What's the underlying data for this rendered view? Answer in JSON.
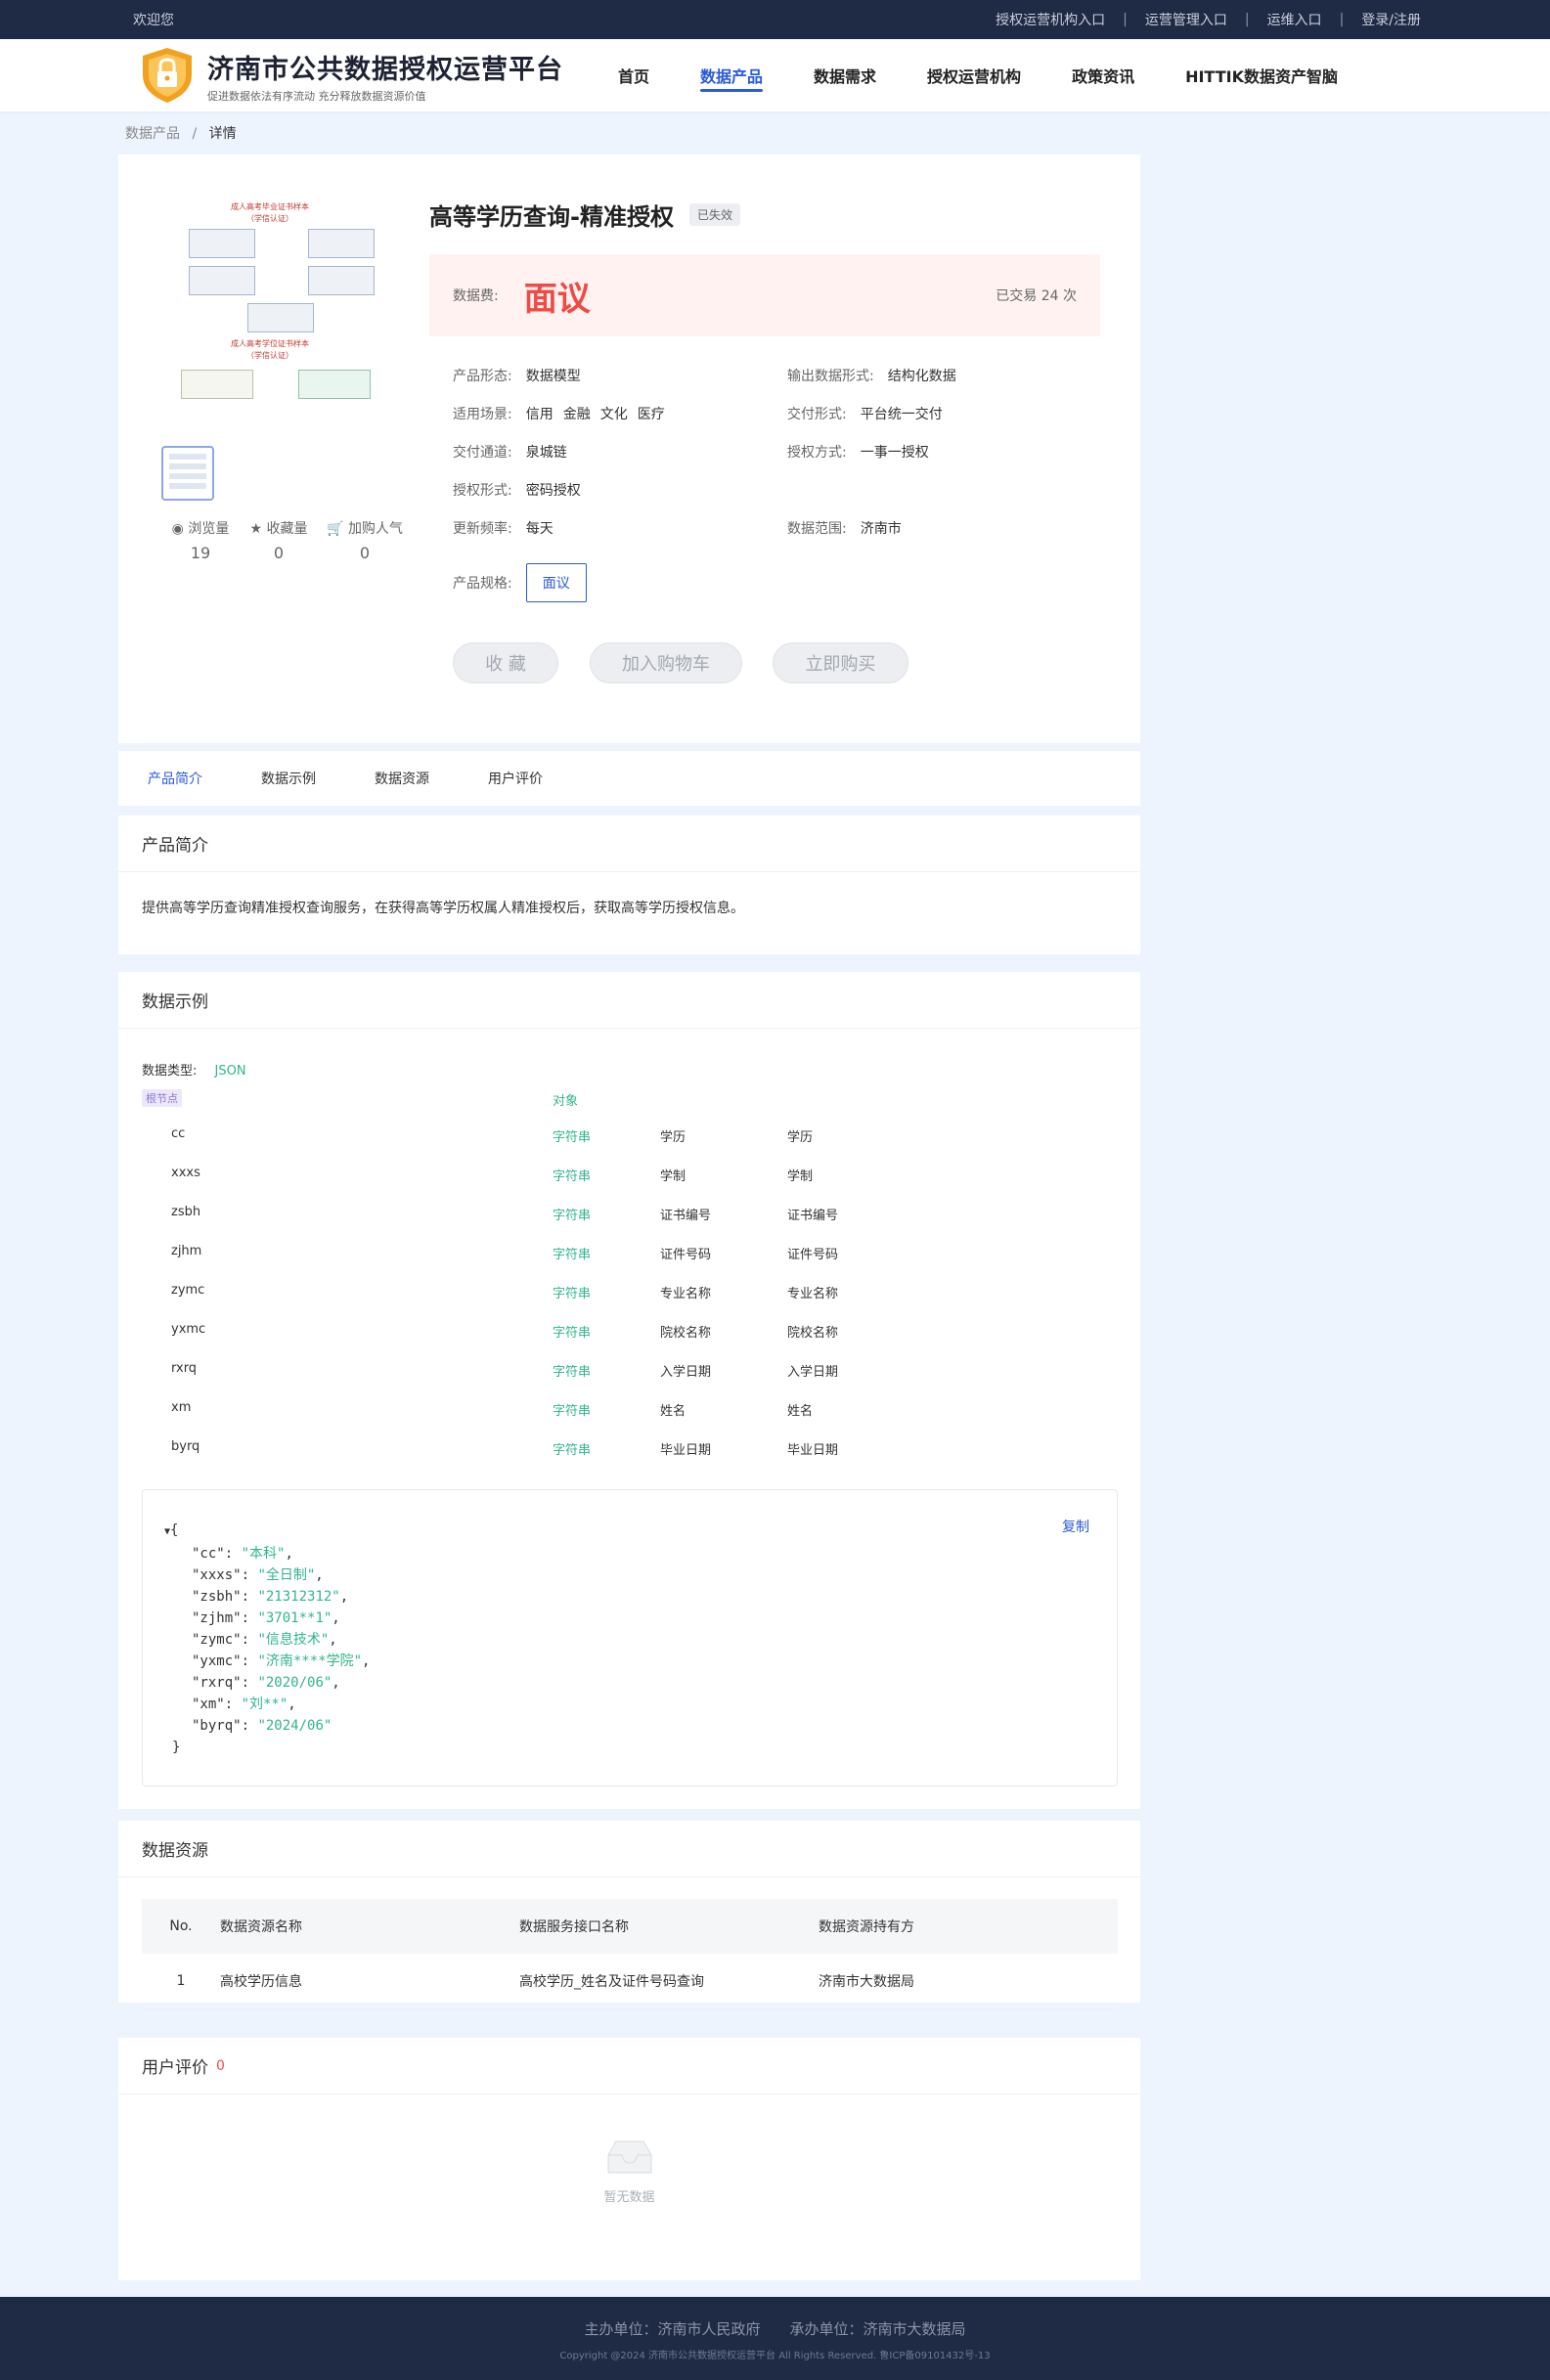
{
  "topbar": {
    "welcome": "欢迎您",
    "links": [
      "授权运营机构入口",
      "运营管理入口",
      "运维入口",
      "登录/注册"
    ]
  },
  "header": {
    "title": "济南市公共数据授权运营平台",
    "subtitle": "促进数据依法有序流动 充分释放数据资源价值",
    "nav": [
      "首页",
      "数据产品",
      "数据需求",
      "授权运营机构",
      "政策资讯",
      "HITTIK数据资产智脑"
    ]
  },
  "breadcrumb": {
    "parent": "数据产品",
    "sep": "/",
    "current": "详情"
  },
  "product": {
    "name": "高等学历查询-精准授权",
    "status": "已失效",
    "fee_label": "数据费:",
    "fee": "面议",
    "traded": "已交易 24 次",
    "stats": [
      {
        "label": "浏览量",
        "value": "19"
      },
      {
        "label": "收藏量",
        "value": "0"
      },
      {
        "label": "加购人气",
        "value": "0"
      }
    ],
    "attrs": {
      "form_l": "产品形态:",
      "form_v": "数据模型",
      "output_l": "输出数据形式:",
      "output_v": "结构化数据",
      "scene_l": "适用场景:",
      "scene_tags": [
        "信用",
        "金融",
        "文化",
        "医疗"
      ],
      "deliver_l": "交付形式:",
      "deliver_v": "平台统一交付",
      "channel_l": "交付通道:",
      "channel_v": "泉城链",
      "authmode_l": "授权方式:",
      "authmode_v": "一事一授权",
      "authform_l": "授权形式:",
      "authform_v": "密码授权",
      "freq_l": "更新频率:",
      "freq_v": "每天",
      "range_l": "数据范围:",
      "range_v": "济南市",
      "spec_l": "产品规格:",
      "spec_v": "面议"
    },
    "buttons": {
      "fav": "收 藏",
      "cart": "加入购物车",
      "buy": "立即购买"
    },
    "image_text": {
      "t1": "成人高考毕业证书样本",
      "t2": "（学信认证）",
      "t3": "成人高考学位证书样本",
      "t4": "（学信认证）"
    }
  },
  "tabs": [
    "产品简介",
    "数据示例",
    "数据资源",
    "用户评价"
  ],
  "intro": {
    "title": "产品简介",
    "text": "提供高等学历查询精准授权查询服务，在获得高等学历权属人精准授权后，获取高等学历授权信息。"
  },
  "example": {
    "title": "数据示例",
    "type_label": "数据类型:",
    "type_value": "JSON",
    "root_tag": "根节点",
    "root_type": "对象",
    "fields": [
      {
        "key": "cc",
        "type": "字符串",
        "name": "学历",
        "desc": "学历"
      },
      {
        "key": "xxxs",
        "type": "字符串",
        "name": "学制",
        "desc": "学制"
      },
      {
        "key": "zsbh",
        "type": "字符串",
        "name": "证书编号",
        "desc": "证书编号"
      },
      {
        "key": "zjhm",
        "type": "字符串",
        "name": "证件号码",
        "desc": "证件号码"
      },
      {
        "key": "zymc",
        "type": "字符串",
        "name": "专业名称",
        "desc": "专业名称"
      },
      {
        "key": "yxmc",
        "type": "字符串",
        "name": "院校名称",
        "desc": "院校名称"
      },
      {
        "key": "rxrq",
        "type": "字符串",
        "name": "入学日期",
        "desc": "入学日期"
      },
      {
        "key": "xm",
        "type": "字符串",
        "name": "姓名",
        "desc": "姓名"
      },
      {
        "key": "byrq",
        "type": "字符串",
        "name": "毕业日期",
        "desc": "毕业日期"
      }
    ],
    "copy": "复制",
    "open": "{",
    "close": "}",
    "json": [
      {
        "k": "\"cc\"",
        "v": "\"本科\""
      },
      {
        "k": "\"xxxs\"",
        "v": "\"全日制\""
      },
      {
        "k": "\"zsbh\"",
        "v": "\"21312312\""
      },
      {
        "k": "\"zjhm\"",
        "v": "\"3701**1\""
      },
      {
        "k": "\"zymc\"",
        "v": "\"信息技术\""
      },
      {
        "k": "\"yxmc\"",
        "v": "\"济南****学院\""
      },
      {
        "k": "\"rxrq\"",
        "v": "\"2020/06\""
      },
      {
        "k": "\"xm\"",
        "v": "\"刘**\""
      },
      {
        "k": "\"byrq\"",
        "v": "\"2024/06\""
      }
    ]
  },
  "resource": {
    "title": "数据资源",
    "headers": [
      "No.",
      "数据资源名称",
      "数据服务接口名称",
      "数据资源持有方"
    ],
    "rows": [
      [
        "1",
        "高校学历信息",
        "高校学历_姓名及证件号码查询",
        "济南市大数据局"
      ]
    ]
  },
  "review": {
    "title": "用户评价",
    "count": "0",
    "empty": "暂无数据"
  },
  "footer": {
    "line1": "主办单位：济南市人民政府　　承办单位：济南市大数据局",
    "line2": "Copyright @2024 济南市公共数据授权运营平台 All Rights Reserved. 鲁ICP备09101432号-13"
  }
}
